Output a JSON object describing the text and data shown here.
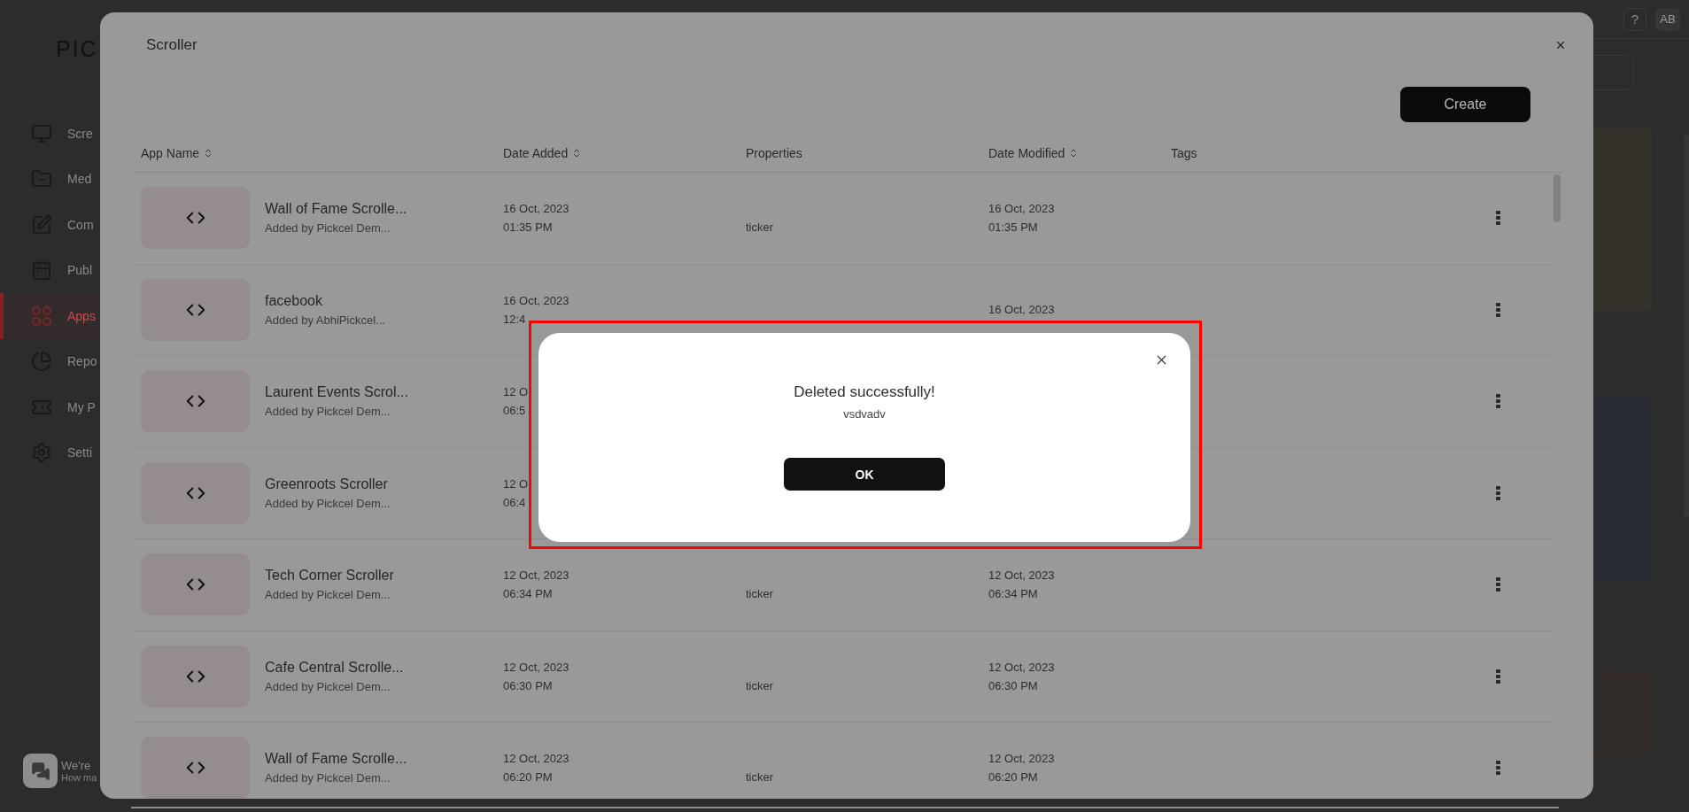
{
  "logo": "PIC",
  "sidebar": {
    "items": [
      {
        "label": "Scre",
        "kind": "monitor",
        "selected": false
      },
      {
        "label": "Med",
        "kind": "folder",
        "selected": false
      },
      {
        "label": "Com",
        "kind": "edit",
        "selected": false
      },
      {
        "label": "Publ",
        "kind": "calendar",
        "selected": false
      },
      {
        "label": "Apps",
        "kind": "grid",
        "selected": true
      },
      {
        "label": "Repo",
        "kind": "chart",
        "selected": false
      },
      {
        "label": "My P",
        "kind": "ticket",
        "selected": false
      },
      {
        "label": "Setti",
        "kind": "gear",
        "selected": false
      }
    ]
  },
  "chat_widget": {
    "title": "We're",
    "subtitle": "How ma"
  },
  "header": {
    "help": "?",
    "avatar": "AB"
  },
  "modal": {
    "title": "Scroller",
    "create_button": "Create",
    "table": {
      "columns": [
        {
          "label": "App Name",
          "sortable": true
        },
        {
          "label": "Date Added",
          "sortable": true
        },
        {
          "label": "Properties",
          "sortable": false
        },
        {
          "label": "Date Modified",
          "sortable": true
        },
        {
          "label": "Tags",
          "sortable": false
        }
      ],
      "rows": [
        {
          "name": "Wall of Fame Scrolle...",
          "added_by": "Added by Pickcel Dem...",
          "date_added": [
            "16 Oct, 2023",
            "01:35 PM"
          ],
          "properties": "ticker",
          "date_modified": [
            "16 Oct, 2023",
            "01:35 PM"
          ]
        },
        {
          "name": "facebook",
          "added_by": "Added by AbhiPickcel...",
          "date_added": [
            "16 Oct, 2023",
            "12:4"
          ],
          "date_modified": [
            "16 Oct, 2023"
          ]
        },
        {
          "name": "Laurent Events Scrol...",
          "added_by": "Added by Pickcel Dem...",
          "date_added": [
            "12 O",
            "06:5"
          ]
        },
        {
          "name": "Greenroots Scroller",
          "added_by": "Added by Pickcel Dem...",
          "date_added": [
            "12 O",
            "06:4"
          ]
        },
        {
          "name": "Tech Corner Scroller",
          "added_by": "Added by Pickcel Dem...",
          "date_added": [
            "12 Oct, 2023",
            "06:34 PM"
          ],
          "properties": "ticker",
          "date_modified": [
            "12 Oct, 2023",
            "06:34 PM"
          ]
        },
        {
          "name": "Cafe Central Scrolle...",
          "added_by": "Added by Pickcel Dem...",
          "date_added": [
            "12 Oct, 2023",
            "06:30 PM"
          ],
          "properties": "ticker",
          "date_modified": [
            "12 Oct, 2023",
            "06:30 PM"
          ]
        },
        {
          "name": "Wall of Fame Scrolle...",
          "added_by": "Added by Pickcel Dem...",
          "date_added": [
            "12 Oct, 2023",
            "06:20 PM"
          ],
          "properties": "ticker",
          "date_modified": [
            "12 Oct, 2023",
            "06:20 PM"
          ]
        }
      ]
    }
  },
  "dialog": {
    "title": "Deleted successfully!",
    "message": "vsdvadv",
    "button": "OK"
  }
}
